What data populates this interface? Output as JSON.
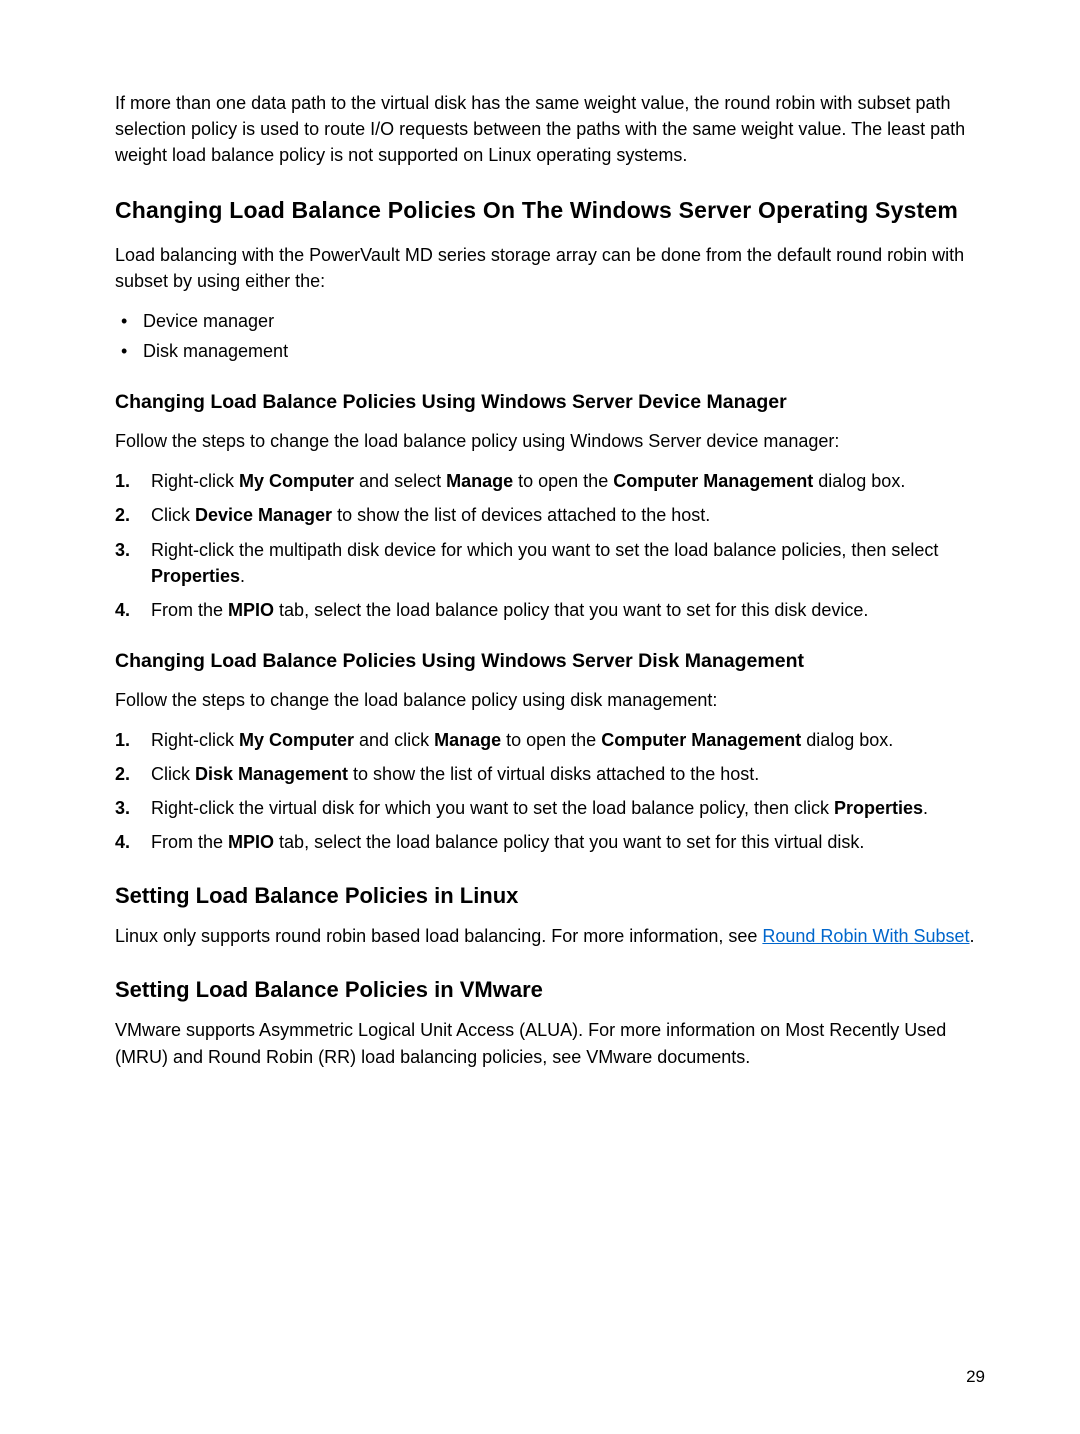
{
  "intro_p": "If more than one data path to the virtual disk has the same weight value, the round robin with subset path selection policy is used to route I/O requests between the paths with the same weight value. The least path weight load balance policy is not supported on Linux operating systems.",
  "sec1": {
    "heading": "Changing Load Balance Policies On The Windows Server Operating System",
    "lead": "Load balancing with the PowerVault MD series storage array can be done from the default round robin with subset by using either the:",
    "bullets": [
      "Device manager",
      "Disk management"
    ],
    "sub1": {
      "heading": "Changing Load Balance Policies Using Windows Server Device Manager",
      "lead": "Follow the steps to change the load balance policy using Windows Server device manager:",
      "steps": {
        "s1_a": "Right-click ",
        "s1_b": "My Computer",
        "s1_c": " and select ",
        "s1_d": "Manage",
        "s1_e": " to open the ",
        "s1_f": "Computer Management",
        "s1_g": " dialog box.",
        "s2_a": "Click ",
        "s2_b": "Device Manager",
        "s2_c": " to show the list of devices attached to the host.",
        "s3_a": "Right-click the multipath disk device for which you want to set the load balance policies, then select ",
        "s3_b": "Properties",
        "s3_c": ".",
        "s4_a": "From the ",
        "s4_b": "MPIO",
        "s4_c": " tab, select the load balance policy that you want to set for this disk device."
      }
    },
    "sub2": {
      "heading": "Changing Load Balance Policies Using Windows Server Disk Management",
      "lead": "Follow the steps to change the load balance policy using disk management:",
      "steps": {
        "s1_a": "Right-click ",
        "s1_b": "My Computer",
        "s1_c": " and click ",
        "s1_d": "Manage",
        "s1_e": " to open the ",
        "s1_f": "Computer Management",
        "s1_g": " dialog box.",
        "s2_a": "Click ",
        "s2_b": "Disk Management",
        "s2_c": " to show the list of virtual disks attached to the host.",
        "s3_a": "Right-click the virtual disk for which you want to set the load balance policy, then click ",
        "s3_b": "Properties",
        "s3_c": ".",
        "s4_a": "From the ",
        "s4_b": "MPIO",
        "s4_c": " tab, select the load balance policy that you want to set for this virtual disk."
      }
    }
  },
  "sec2": {
    "heading": "Setting Load Balance Policies in Linux",
    "p1_a": "Linux only supports round robin based load balancing. For more information, see ",
    "p1_link1": "Round Robin With ",
    "p1_link2": "Subset",
    "p1_c": "."
  },
  "sec3": {
    "heading": "Setting Load Balance Policies in VMware",
    "p1": "VMware supports Asymmetric Logical Unit Access (ALUA). For more information on Most Recently Used (MRU) and Round Robin (RR) load balancing policies, see VMware documents."
  },
  "page_number": "29"
}
